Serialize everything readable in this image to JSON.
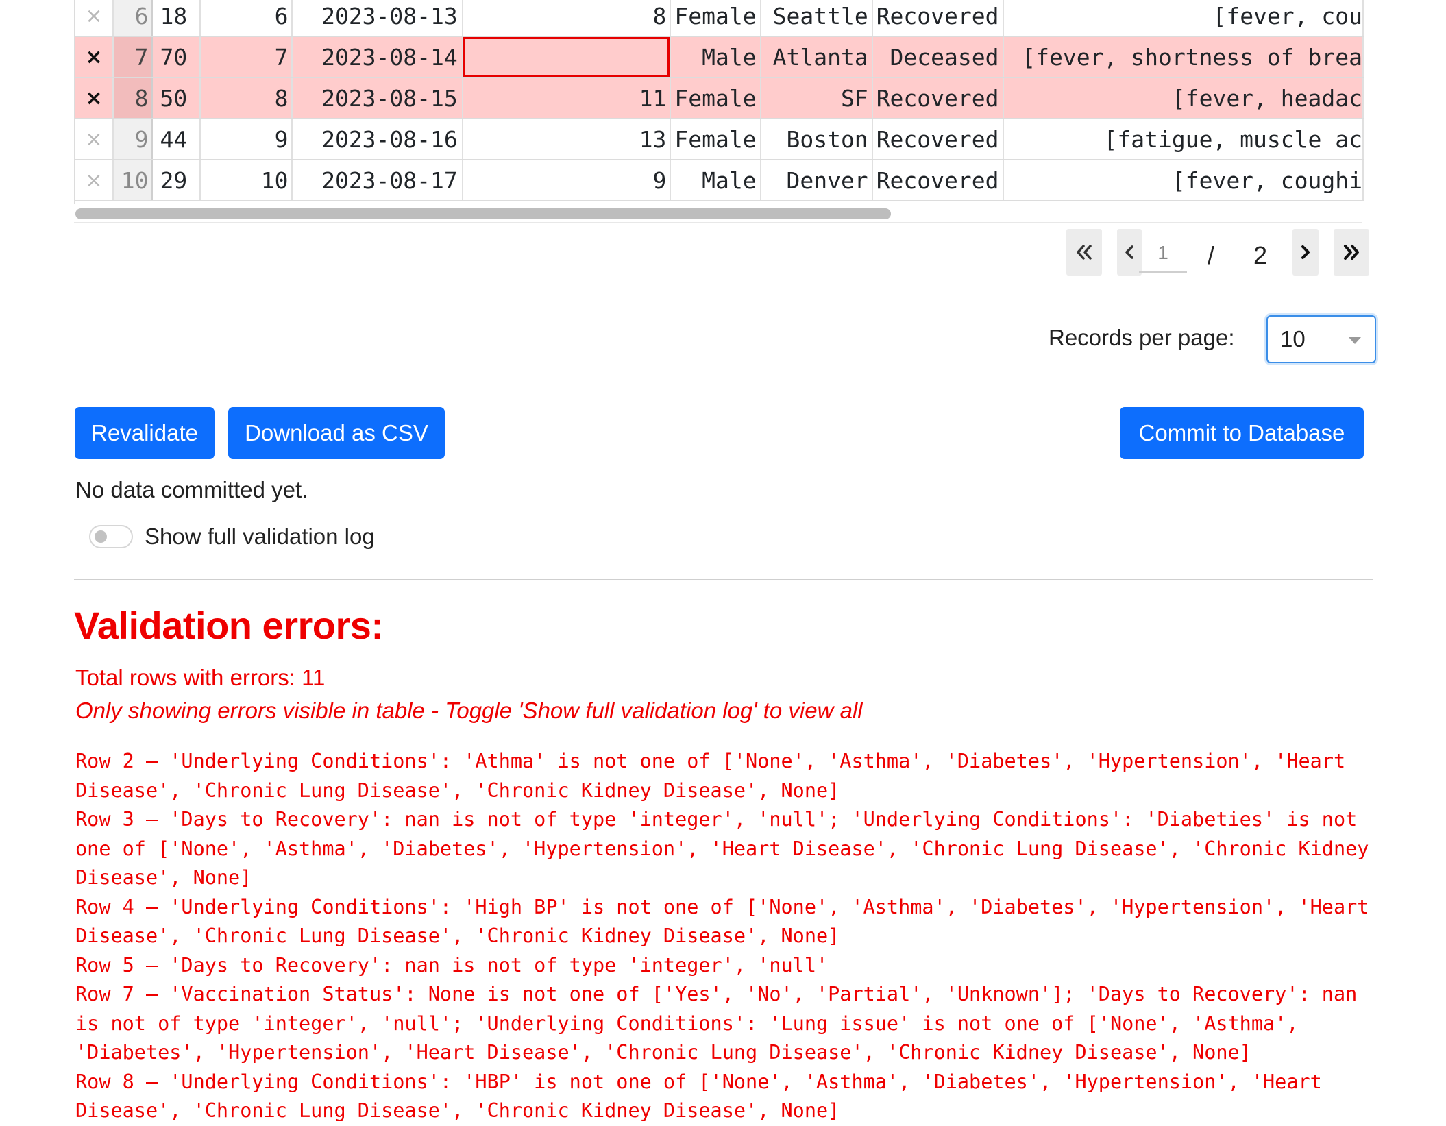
{
  "table": {
    "rows": [
      {
        "idx": "6",
        "age": "18",
        "id": "6",
        "date": "2023-08-13",
        "vaccination": "",
        "days": "8",
        "gender": "Female",
        "city": "Seattle",
        "outcome": "Recovered",
        "symptoms": "[fever, cou",
        "error": false
      },
      {
        "idx": "7",
        "age": "70",
        "id": "7",
        "date": "2023-08-14",
        "vaccination": "",
        "days": "",
        "gender": "Male",
        "city": "Atlanta",
        "outcome": "Deceased",
        "symptoms": "[fever, shortness of brea",
        "error": true
      },
      {
        "idx": "8",
        "age": "50",
        "id": "8",
        "date": "2023-08-15",
        "vaccination": "",
        "days": "11",
        "gender": "Female",
        "city": "SF",
        "outcome": "Recovered",
        "symptoms": "[fever, headac",
        "error": true
      },
      {
        "idx": "9",
        "age": "44",
        "id": "9",
        "date": "2023-08-16",
        "vaccination": "",
        "days": "13",
        "gender": "Female",
        "city": "Boston",
        "outcome": "Recovered",
        "symptoms": "[fatigue, muscle ac",
        "error": false
      },
      {
        "idx": "10",
        "age": "29",
        "id": "10",
        "date": "2023-08-17",
        "vaccination": "",
        "days": "9",
        "gender": "Male",
        "city": "Denver",
        "outcome": "Recovered",
        "symptoms": "[fever, coughi",
        "error": false
      }
    ],
    "delete_glyph": "×"
  },
  "pagination": {
    "current_page": "1",
    "separator": "/",
    "total_pages": "2"
  },
  "records_per_page": {
    "label": "Records per page:",
    "value": "10"
  },
  "buttons": {
    "revalidate": "Revalidate",
    "download_csv": "Download as CSV",
    "commit": "Commit to Database"
  },
  "status_text": "No data committed yet.",
  "toggle": {
    "label": "Show full validation log",
    "checked": false
  },
  "validation": {
    "title": "Validation errors:",
    "total": "Total rows with errors: 11",
    "note": "Only showing errors visible in table - Toggle 'Show full validation log' to view all",
    "errors": [
      "Row 2 – 'Underlying Conditions': 'Athma' is not one of ['None', 'Asthma', 'Diabetes', 'Hypertension', 'Heart Disease', 'Chronic Lung Disease', 'Chronic Kidney Disease', None]",
      "Row 3 – 'Days to Recovery': nan is not of type 'integer', 'null'; 'Underlying Conditions': 'Diabeties' is not one of ['None', 'Asthma', 'Diabetes', 'Hypertension', 'Heart Disease', 'Chronic Lung Disease', 'Chronic Kidney Disease', None]",
      "Row 4 – 'Underlying Conditions': 'High BP' is not one of ['None', 'Asthma', 'Diabetes', 'Hypertension', 'Heart Disease', 'Chronic Lung Disease', 'Chronic Kidney Disease', None]",
      "Row 5 – 'Days to Recovery': nan is not of type 'integer', 'null'",
      "Row 7 – 'Vaccination Status': None is not one of ['Yes', 'No', 'Partial', 'Unknown']; 'Days to Recovery': nan is not of type 'integer', 'null'; 'Underlying Conditions': 'Lung issue' is not one of ['None', 'Asthma', 'Diabetes', 'Hypertension', 'Heart Disease', 'Chronic Lung Disease', 'Chronic Kidney Disease', None]",
      "Row 8 – 'Underlying Conditions': 'HBP' is not one of ['None', 'Asthma', 'Diabetes', 'Hypertension', 'Heart Disease', 'Chronic Lung Disease', 'Chronic Kidney Disease', None]"
    ]
  },
  "colors": {
    "error_row_bg": "#ffcccc",
    "error_text": "#ee0000",
    "primary_button": "#0d6efd"
  },
  "icons": {
    "first_page": "double-chevron-left-icon",
    "prev_page": "chevron-left-icon",
    "next_page": "chevron-right-icon",
    "last_page": "double-chevron-right-icon",
    "select_caret": "caret-down-icon",
    "delete_row": "close-icon"
  }
}
